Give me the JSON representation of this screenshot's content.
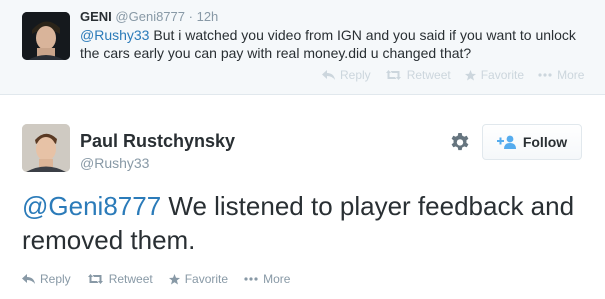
{
  "reply": {
    "name": "GENI",
    "handle": "@Geni8777",
    "separator": "·",
    "time": "12h",
    "mention": "@Rushy33",
    "text": " But i watched you video from IGN and you said if you want to unlock the cars early you can pay with real money.did u changed that?",
    "actions": {
      "reply": "Reply",
      "retweet": "Retweet",
      "favorite": "Favorite",
      "more": "More"
    }
  },
  "main": {
    "name": "Paul Rustchynsky",
    "handle": "@Rushy33",
    "follow_label": "Follow",
    "mention": "@Geni8777",
    "text": " We listened to player feedback and removed them.",
    "actions": {
      "reply": "Reply",
      "retweet": "Retweet",
      "favorite": "Favorite",
      "more": "More"
    }
  },
  "colors": {
    "link": "#2b7bb9",
    "follow_icon": "#55acee",
    "muted": "#8899a6",
    "faint": "#ccd6dd"
  }
}
